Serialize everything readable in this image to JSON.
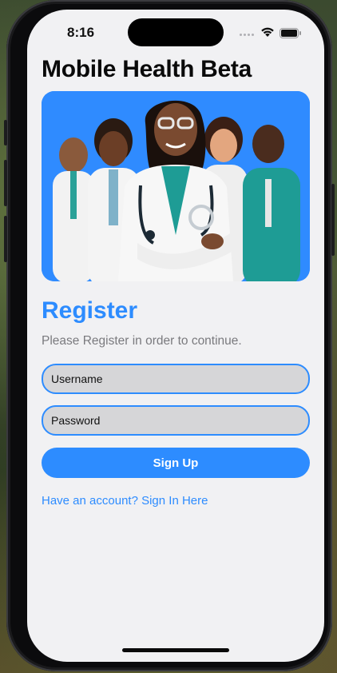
{
  "status_bar": {
    "time": "8:16"
  },
  "app": {
    "title": "Mobile Health Beta"
  },
  "hero_image": {
    "description_icon": "medical-team-illustration"
  },
  "register": {
    "heading": "Register",
    "subtitle": "Please Register in order to continue.",
    "username_placeholder": "Username",
    "password_placeholder": "Password",
    "signup_label": "Sign Up",
    "signin_link": "Have an account? Sign In Here"
  },
  "colors": {
    "accent": "#2d8cff",
    "screen_bg": "#f1f1f3",
    "field_bg": "#d6d6d8"
  }
}
